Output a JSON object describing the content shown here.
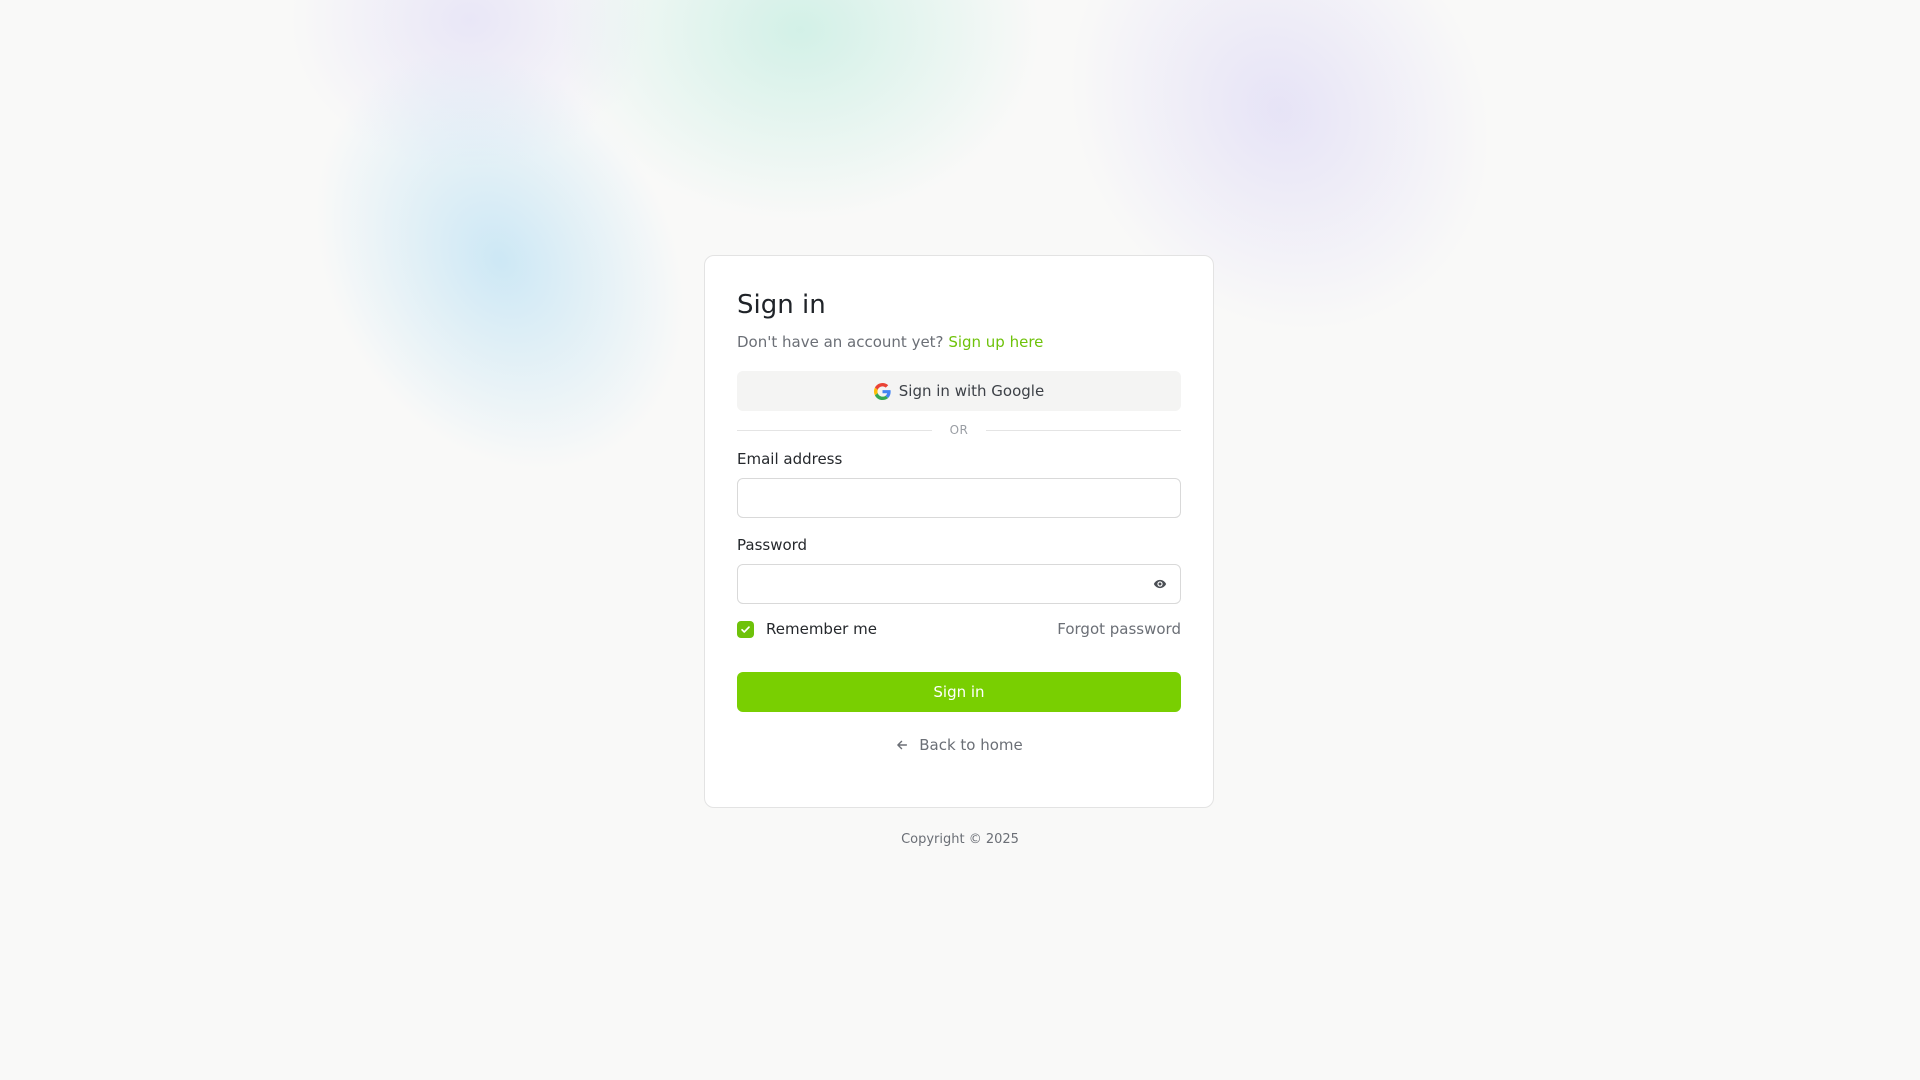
{
  "colors": {
    "accent": "#79cf01",
    "link": "#6ec20a",
    "background": "#f9f9f8",
    "card": "#ffffff"
  },
  "signin": {
    "title": "Sign in",
    "no_account_text": "Don't have an account yet?",
    "signup_link": "Sign up here",
    "google_button": {
      "label": "Sign in with Google",
      "icon": "google-icon"
    },
    "divider_text": "OR",
    "email": {
      "label": "Email address",
      "value": "",
      "placeholder": ""
    },
    "password": {
      "label": "Password",
      "value": "",
      "placeholder": "",
      "toggle_icon": "eye-icon"
    },
    "remember_me": {
      "label": "Remember me",
      "checked": true
    },
    "forgot_password": "Forgot password",
    "submit_label": "Sign in",
    "back_link": {
      "label": "Back to home",
      "icon": "arrow-left-icon"
    }
  },
  "footer": {
    "copyright": "Copyright © 2025"
  }
}
